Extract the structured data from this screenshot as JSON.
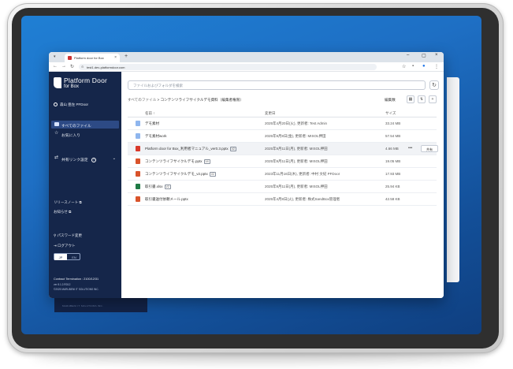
{
  "browser": {
    "tab_title": "Platform door for Box",
    "tab_close": "×",
    "new_tab": "+",
    "url": "test1.dev-platformdoor.com",
    "window_controls": [
      "–",
      "▢",
      "×"
    ]
  },
  "sidebar": {
    "brand_name": "Platform Door",
    "brand_sub": "for Box",
    "user_name": "森山 亜左 PFDoor",
    "nav": [
      {
        "label": "すべてのファイル",
        "icon": "folder-icon",
        "active": true
      },
      {
        "label": "お気に入り",
        "icon": "star-icon",
        "active": false
      }
    ],
    "shared_link_label": "共有リンク設定",
    "shared_link_help": "?",
    "release_notes": "リリースノート ⧉",
    "notices": "お知らせ ⧉",
    "password_change": "パスワード変更",
    "logout": "ログアウト",
    "lang_jp": "JP",
    "lang_en": "EN",
    "contract_termination": "Contract Termination : 2100/12/31",
    "version": "ver 8.1.2.RD12",
    "copyright": "©2025 MARUBENI IT SOLUTIONS INC."
  },
  "main": {
    "search_placeholder": "ファイルおよびフォルダを検索",
    "breadcrumb_root": "すべてのファイル",
    "breadcrumb_separator": " > ",
    "breadcrumb_current": "コンテンツライフサイクルデモ資料（編集者権限）",
    "edit_count": "編集数",
    "columns": {
      "name": "名前 ↑",
      "modified": "変更日",
      "size": "サイズ"
    },
    "rows": [
      {
        "type": "folder",
        "name": "デモ素材",
        "version": "",
        "modified": "2025年4月20日(火), 更新者: Test Admin",
        "size": "33.24 MB"
      },
      {
        "type": "folder",
        "name": "デモ素材work",
        "version": "",
        "modified": "2025年9月8日(金), 更新者: MISOL押田",
        "size": "57.54 MB"
      },
      {
        "type": "pdf",
        "name": "Platform door for Box_利用者マニュアル_ver0.3.pptx",
        "version": "V2",
        "modified": "2025年9月11日(月), 更新者: MISOL押田",
        "size": "4.66 MB",
        "more": "•••",
        "share": "共有"
      },
      {
        "type": "pptx",
        "name": "コンテンツライフサイクルデモ.pptx",
        "version": "V4",
        "modified": "2025年9月11日(月), 更新者: MISOL押田",
        "size": "19.05 MB"
      },
      {
        "type": "pptx",
        "name": "コンテンツライフサイクルデモ_v2.pptx",
        "version": "V2",
        "modified": "2023年11月16日(木), 更新者: 中村 文紀 PFDoor",
        "size": "17.93 MB"
      },
      {
        "type": "xlsx",
        "name": "取引書.xlsx",
        "version": "V2",
        "modified": "2025年9月11日(月), 更新者: MISOL押田",
        "size": "25.94 KB"
      },
      {
        "type": "pptx",
        "name": "取引書送付依頼メール.pptx",
        "version": "",
        "modified": "2025年4月8日(火), 更新者: 株式SandBox管理者",
        "size": "42.58 KB"
      }
    ]
  },
  "background": {
    "footer_text": "MARUBENI IT SOLUTIONS INC."
  },
  "colors": {
    "sidebar": "#15264a",
    "active": "#2d4a85",
    "folder": "#8fb6ee",
    "pdf": "#d9392b",
    "pptx": "#d9532b",
    "xlsx": "#1f7a45"
  }
}
